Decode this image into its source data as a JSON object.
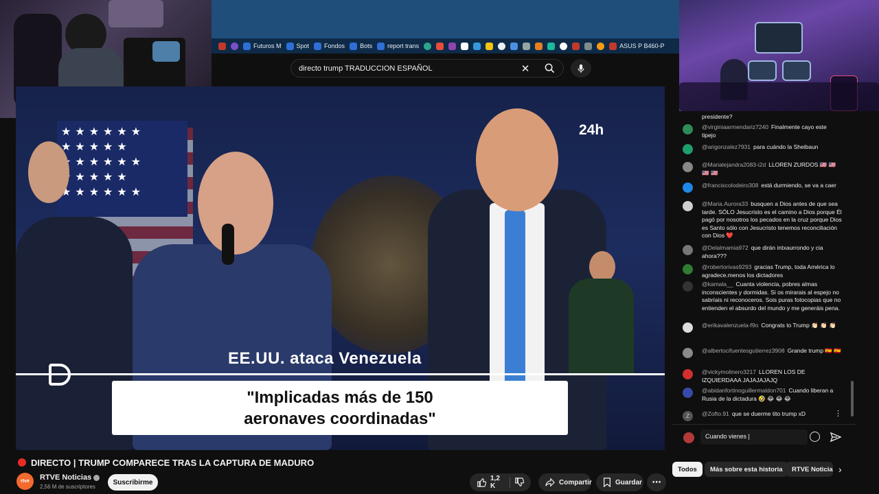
{
  "bookmarks": [
    {
      "label": "",
      "color": "#c0392b"
    },
    {
      "label": "",
      "color": "#7a4fc9"
    },
    {
      "label": "Futuros M",
      "color": "#2d6fd6"
    },
    {
      "label": "Spot",
      "color": "#2d6fd6"
    },
    {
      "label": "Fondos",
      "color": "#2d6fd6"
    },
    {
      "label": "Bots",
      "color": "#2d6fd6"
    },
    {
      "label": "report trans",
      "color": "#2d6fd6"
    },
    {
      "label": "ASUS P B460-P",
      "color": "#c0392b"
    }
  ],
  "search": {
    "query": "directo trump TRADUCCION ESPAÑOL"
  },
  "video": {
    "channel_badge": "24h",
    "headline": "EE.UU. ataca Venezuela",
    "quote_line1": "\"Implicadas más de 150",
    "quote_line2": "aeronaves coordinadas\""
  },
  "title": "DIRECTO | TRUMP COMPARECE TRAS LA CAPTURA DE MADURO",
  "channel": {
    "name": "RTVE Noticias",
    "subscribers": "2,56 M de suscriptores",
    "avatar_text": "rtve",
    "subscribe_label": "Suscribirme"
  },
  "actions": {
    "likes": "1,2 K",
    "share": "Compartir",
    "save": "Guardar"
  },
  "chat": {
    "messages": [
      {
        "author": "",
        "text": "presidente?",
        "avatar_color": "#555555"
      },
      {
        "author": "@virginiaarmendariz7240",
        "text": "Finalmente cayo este tipejo",
        "avatar_color": "#2e8b57"
      },
      {
        "author": "@arigonzalez7931",
        "text": "para cuándo la Sheibaun",
        "avatar_color": "#1e9e6a"
      },
      {
        "author": "@Marialejandra2083-i2d",
        "text": "LLOREN ZURDOS 🇺🇸 🇺🇸 🇺🇸 🇺🇸",
        "avatar_color": "#888888"
      },
      {
        "author": "@franciscolodeiro308",
        "text": "está durmiendo, se va a caer",
        "avatar_color": "#1e88e5"
      },
      {
        "author": "@Maria.Aurora33",
        "text": "busquen a Dios antes de que sea tarde. SÓLO Jesucristo es el camino a Dios porque Él pagó por nosotros los pecados en la cruz porque Dios es Santo sólo con Jesucristo tenemos reconciliación con Dios ❤️",
        "avatar_color": "#cfcfcf"
      },
      {
        "author": "@Delalmamia972",
        "text": "que dirán intxaurrondo y cia ahora???",
        "avatar_color": "#777777"
      },
      {
        "author": "@robertorivas9293",
        "text": "gracias Trump, toda América lo agradece.menos los dictadores",
        "avatar_color": "#2e7d32"
      },
      {
        "author": "@kamala__",
        "text": "Cuanta violencia, pobres almas inconscientes y dormidas. Si os mirarais al espejo no sabríais ni reconoceros. Sois puras fotocopias que no entienden el absurdo del mundo y me generáis pena.",
        "avatar_color": "#333333"
      },
      {
        "author": "@erikavalenzuela-f9o",
        "text": "Congrats to Trump 👏🏻 👏🏻 👏🏻",
        "avatar_color": "#dddddd"
      },
      {
        "author": "@albertocifuentesgutierrez3908",
        "text": "Grande trump 🇪🇸 🇪🇸",
        "avatar_color": "#8a8a8a"
      },
      {
        "author": "@vickymolinero3217",
        "text": "LLOREN LOS DE IZQUIERDAAA JAJAJAJAJQ",
        "avatar_color": "#d32f2f"
      },
      {
        "author": "@abidanfortinoguillermaldon701",
        "text": "Cuando liberan a Rusia de la dictadura 🤣 😂 😂 😂",
        "avatar_color": "#3949ab"
      },
      {
        "author": "@Zofto.91",
        "text": "que se duerme tito trump xD",
        "avatar_color": "#555555",
        "avatar_text": "Z"
      }
    ],
    "input_value": "Cuando vienes |"
  },
  "chips": [
    "Todos",
    "Más sobre esta historia",
    "RTVE Noticias"
  ],
  "colors": {
    "accent_red": "#e52d27",
    "bg": "#0f0f0f",
    "chip_bg": "#272727"
  }
}
